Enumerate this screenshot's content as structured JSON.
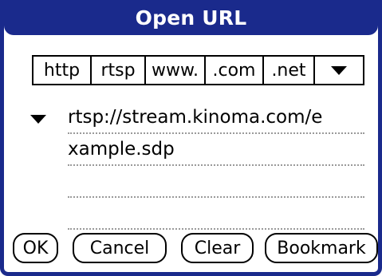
{
  "dialog": {
    "title": "Open URL"
  },
  "shortcuts": [
    {
      "label": "http"
    },
    {
      "label": "rtsp"
    },
    {
      "label": "www."
    },
    {
      "label": ".com"
    },
    {
      "label": ".net"
    }
  ],
  "icons": {
    "shortcut_more": "triangle-down-icon",
    "history": "triangle-down-icon"
  },
  "url": {
    "line1": "rtsp://stream.kinoma.com/e",
    "line2": "xample.sdp",
    "line3": "",
    "line4": ""
  },
  "buttons": {
    "ok": "OK",
    "cancel": "Cancel",
    "clear": "Clear",
    "bookmark": "Bookmark"
  },
  "colors": {
    "frame": "#1a2a8c",
    "background": "#ffffff",
    "dotted_line": "#9a9a9a"
  }
}
